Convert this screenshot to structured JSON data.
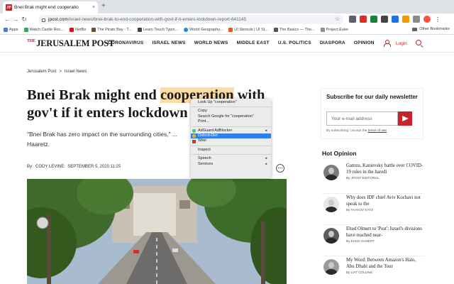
{
  "browser": {
    "tab_title": "Bnei Brak might end cooperatio",
    "tab_close": "×",
    "new_tab": "+",
    "nav": {
      "back": "←",
      "forward": "→",
      "reload": "↻"
    },
    "url_host": "jpost.com",
    "url_path": "/israel-news/bnei-brak-to-end-cooperation-with-govt-if-it-enters-lockdown-report-641145",
    "star": "☆",
    "bookmarks": [
      {
        "label": "Apps",
        "color": "#4a7bd6"
      },
      {
        "label": "Watch Castle Roc...",
        "color": "#3aa757"
      },
      {
        "label": "Netflix",
        "color": "#e50914"
      },
      {
        "label": "The Pirate Bay - T...",
        "color": "#6b4f2a"
      },
      {
        "label": "Learn Touch Typin...",
        "color": "#444444"
      },
      {
        "label": "World Geography...",
        "color": "#1e88e5"
      },
      {
        "label": "UI Stencils | UI St...",
        "color": "#f4511e"
      },
      {
        "label": "The Basics — The...",
        "color": "#555555"
      },
      {
        "label": "Project Euler",
        "color": "#8e8e8e"
      }
    ],
    "other_bookmarks": "Other Bookmarks"
  },
  "site": {
    "logo_the": "THE",
    "logo_name": "JERUSALEM POST",
    "nav": [
      "CORONAVIRUS",
      "ISRAEL NEWS",
      "WORLD NEWS",
      "MIDDLE EAST",
      "U.S. POLITICS",
      "DIASPORA",
      "OPINION"
    ],
    "login": "Login"
  },
  "article": {
    "breadcrumb": [
      "Jerusalem Post",
      ">",
      "Israel News"
    ],
    "headline_before": "Bnei Brak might end ",
    "headline_highlight": "cooperation",
    "headline_after": " with gov't if it enters lockdown - report",
    "lede": "\"Bnei Brak has zero impact on the surrounding cities,\" ... Haaretz.",
    "byline_prefix": "By",
    "author": "CODY LEVINE",
    "date": "SEPTEMBER 5, 2020 11:25"
  },
  "sidebar": {
    "subscribe_title": "Subscribe for our daily newsletter",
    "email_placeholder": "Your e-mail address",
    "terms_prefix": "By subscribing I accept the",
    "terms_link": "terms of use",
    "hot_opinion_title": "Hot Opinion",
    "hot_opinion": [
      {
        "title": "Gamzu, Kanievsky battle over COVID-19 rules in the haredi",
        "author": "By JPOST EDITORIAL"
      },
      {
        "title": "Why does IDF chief Aviv Kochavi not speak to the",
        "author": "By YAAKOV KATZ"
      },
      {
        "title": "Ehud Olmert to 'Post': Israel's divisions have reached near-",
        "author": "By EHUD OLMERT"
      },
      {
        "title": "My Word: Between Amazon's Halo, Abu Dhabi and the Tour",
        "author": "By LIAT COLLINS"
      }
    ]
  },
  "context_menu": {
    "items": [
      {
        "label": "Look Up \"cooperation\""
      },
      {
        "separator": true
      },
      {
        "label": "Copy"
      },
      {
        "label": "Search Google for \"cooperation\""
      },
      {
        "label": "Print..."
      },
      {
        "separator": true
      },
      {
        "label": "AdGuard AdBlocker",
        "submenu": true,
        "icon": "adguard"
      },
      {
        "label": "Oxford-Dict",
        "selected": true,
        "icon": "oxford"
      },
      {
        "label": "Wikit",
        "icon": "wikit"
      },
      {
        "separator": true
      },
      {
        "label": "Inspect"
      },
      {
        "separator": true
      },
      {
        "label": "Speech",
        "submenu": true
      },
      {
        "label": "Services",
        "submenu": true
      }
    ],
    "submenu_arrow": "▸"
  }
}
